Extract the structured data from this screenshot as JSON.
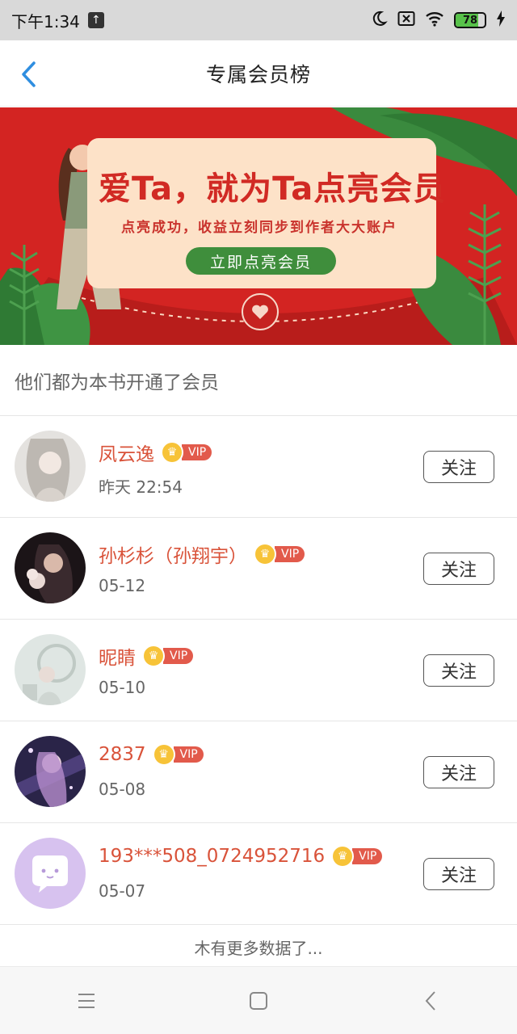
{
  "status_bar": {
    "time": "下午1:34",
    "battery": "78",
    "icons": [
      "upload-icon",
      "moon-icon",
      "sim-x-icon",
      "wifi-icon",
      "battery-icon",
      "charging-icon"
    ]
  },
  "header": {
    "title": "专属会员榜",
    "back_icon": "chevron-left-icon"
  },
  "banner": {
    "headline": "爱Ta，就为Ta点亮会员",
    "subline": "点亮成功，收益立刻同步到作者大大账户",
    "cta": "立即点亮会员"
  },
  "section": {
    "title": "他们都为本书开通了会员"
  },
  "members": [
    {
      "name": "凤云逸",
      "badge": "VIP",
      "time": "昨天 22:54",
      "action": "关注"
    },
    {
      "name": "孙杉杉（孙翔宇）",
      "badge": "VIP",
      "time": "05-12",
      "action": "关注"
    },
    {
      "name": "昵睛",
      "badge": "VIP",
      "time": "05-10",
      "action": "关注"
    },
    {
      "name": "2837",
      "badge": "VIP",
      "time": "05-08",
      "action": "关注"
    },
    {
      "name": "193***508_0724952716",
      "badge": "VIP",
      "time": "05-07",
      "action": "关注"
    }
  ],
  "footer": {
    "message": "木有更多数据了..."
  },
  "colors": {
    "accent_blue": "#2f8ee0",
    "name_red": "#d9533a",
    "banner_red": "#d32422",
    "cta_green": "#3f8e3c",
    "vip_red": "#e25a4b",
    "crown_gold": "#f7c338"
  }
}
